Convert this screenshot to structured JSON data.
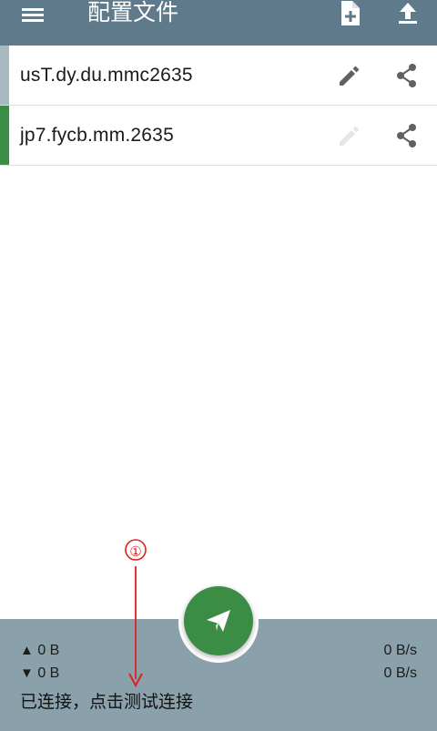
{
  "appbar": {
    "title": "配置文件",
    "icons": [
      "menu-icon",
      "add-file-icon",
      "upload-icon"
    ]
  },
  "profiles": [
    {
      "name": "usT.dy.du.mmc2635",
      "indicator_color": "#a9b9c2",
      "edit_enabled": true
    },
    {
      "name": "jp7.fycb.mm.2635",
      "indicator_color": "#3b8c45",
      "edit_enabled": false
    }
  ],
  "annotation": {
    "marker": "①",
    "color": "#e02020"
  },
  "bottom": {
    "upload_total": "0 B",
    "download_total": "0 B",
    "upload_speed": "0 B/s",
    "download_speed": "0 B/s",
    "status": "已连接，点击测试连接",
    "up_arrow": "▲",
    "down_arrow": "▼"
  },
  "colors": {
    "appbar": "#5f7a8a",
    "bottombar": "#8aa0ab",
    "fab": "#3b8c45",
    "accent": "#3b8c45"
  }
}
